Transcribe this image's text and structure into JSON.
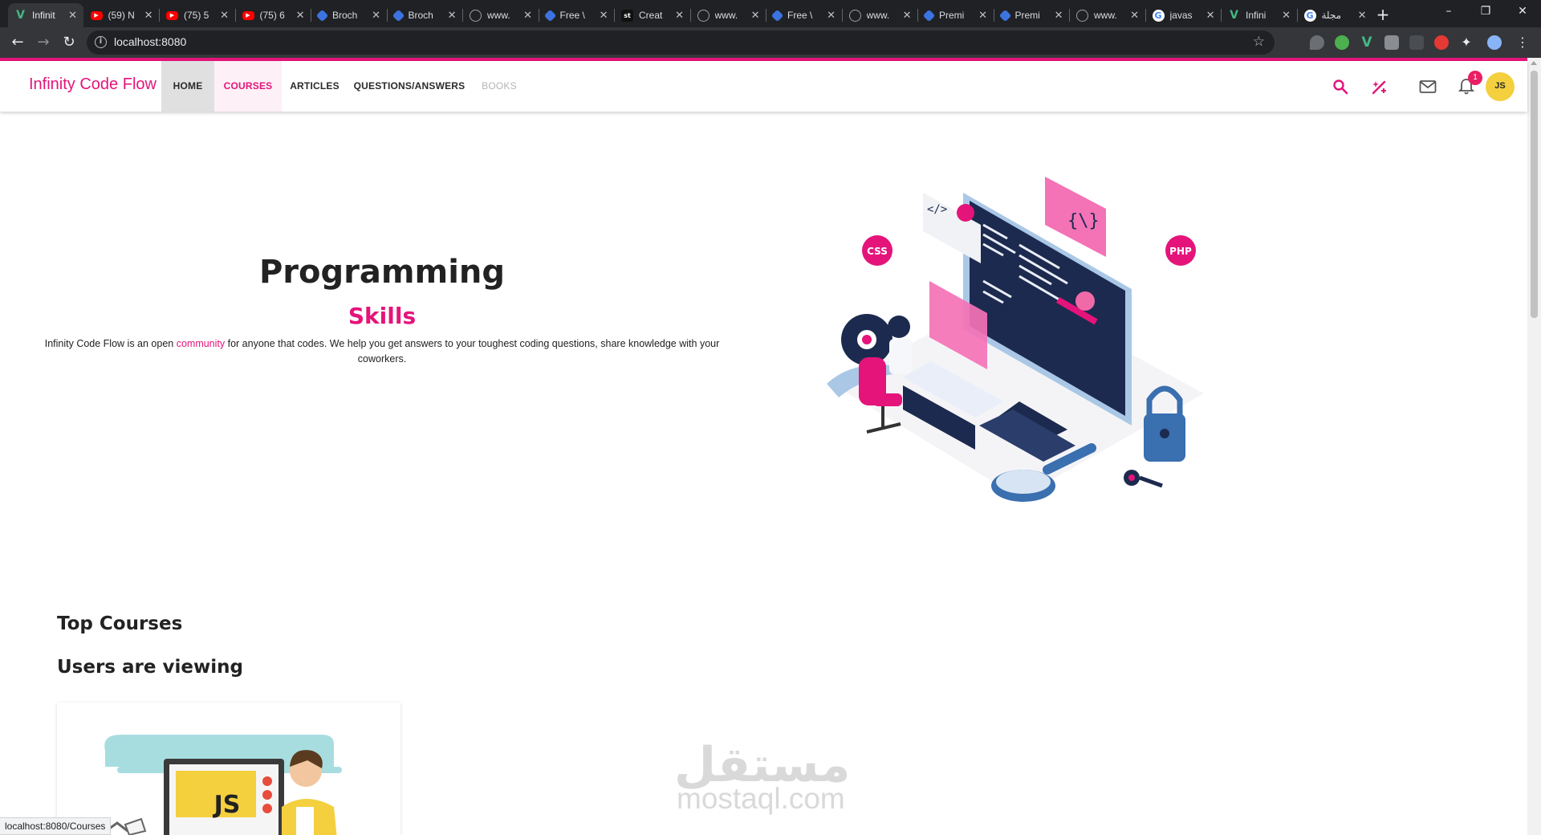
{
  "browser": {
    "tabs": [
      {
        "title": "Infinit",
        "favicon": "vue-icon",
        "color": "#42b883",
        "active": true
      },
      {
        "title": "(59) N",
        "favicon": "youtube-icon",
        "color": "#ff0000",
        "active": false
      },
      {
        "title": "(75) 5",
        "favicon": "youtube-icon",
        "color": "#ff0000",
        "active": false
      },
      {
        "title": "(75) 6",
        "favicon": "youtube-icon",
        "color": "#ff0000",
        "active": false
      },
      {
        "title": "Broch",
        "favicon": "site-icon",
        "color": "#3b73e0",
        "active": false
      },
      {
        "title": "Broch",
        "favicon": "site-icon",
        "color": "#3b73e0",
        "active": false
      },
      {
        "title": "www.",
        "favicon": "globe-icon",
        "color": "#9aa0a6",
        "active": false
      },
      {
        "title": "Free \\",
        "favicon": "site-icon",
        "color": "#3b73e0",
        "active": false
      },
      {
        "title": "Creat",
        "favicon": "st-icon",
        "color": "#111111",
        "active": false
      },
      {
        "title": "www.",
        "favicon": "globe-icon",
        "color": "#9aa0a6",
        "active": false
      },
      {
        "title": "Free \\",
        "favicon": "site-icon",
        "color": "#3b73e0",
        "active": false
      },
      {
        "title": "www.",
        "favicon": "globe-icon",
        "color": "#9aa0a6",
        "active": false
      },
      {
        "title": "Premi",
        "favicon": "site-icon",
        "color": "#3b73e0",
        "active": false
      },
      {
        "title": "Premi",
        "favicon": "site-icon",
        "color": "#3b73e0",
        "active": false
      },
      {
        "title": "www.",
        "favicon": "globe-icon",
        "color": "#9aa0a6",
        "active": false
      },
      {
        "title": "javas",
        "favicon": "google-icon",
        "color": "#ffffff",
        "active": false
      },
      {
        "title": "Infini",
        "favicon": "vue-icon",
        "color": "#42b883",
        "active": false
      },
      {
        "title": "مجلة",
        "favicon": "google-icon",
        "color": "#ffffff",
        "active": false
      }
    ],
    "url": "localhost:8080",
    "status_url": "localhost:8080/Courses"
  },
  "site": {
    "logo": "Infinity Code Flow",
    "nav": {
      "home": "HOME",
      "courses": "COURSES",
      "articles": "ARTICLES",
      "qa": "QUESTIONS/ANSWERS",
      "books": "BOOKS"
    },
    "notification_count": "1",
    "avatar_initials": "JS",
    "accent_color": "#e4147a"
  },
  "hero": {
    "title": "Programming",
    "subtitle": "Skills",
    "desc_before": "Infinity Code Flow is an open ",
    "desc_highlight": "community",
    "desc_after": " for anyone that codes. We help you get answers to your toughest coding questions, share knowledge with your coworkers.",
    "illustration_labels": {
      "css": "CSS",
      "php": "PHP"
    }
  },
  "sections": {
    "top_courses": "Top Courses",
    "users_viewing": "Users are viewing"
  },
  "course_card": {
    "badge_text": "JS"
  },
  "watermark": {
    "arabic": "مستقل",
    "latin": "mostaql.com"
  }
}
